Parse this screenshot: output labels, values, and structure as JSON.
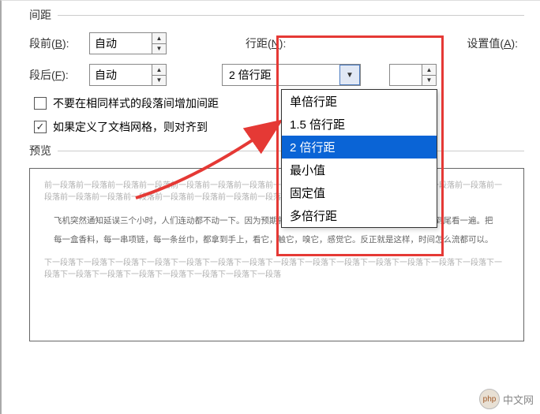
{
  "spacing": {
    "title": "间距",
    "before_label": "段前(B):",
    "after_label": "段后(F):",
    "before_value": "自动",
    "after_value": "自动",
    "line_spacing_label": "行距(N):",
    "line_spacing_value": "2 倍行距",
    "set_value_label": "设置值(A):",
    "set_value": ""
  },
  "dropdown_options": [
    "单倍行距",
    "1.5 倍行距",
    "2 倍行距",
    "最小值",
    "固定值",
    "多倍行距"
  ],
  "dropdown_selected_index": 2,
  "checkboxes": {
    "no_space_same_style": {
      "label": "不要在相同样式的段落间增加间距",
      "checked": false
    },
    "snap_to_grid": {
      "label": "如果定义了文档网格，则对齐到",
      "checked": true
    }
  },
  "preview": {
    "title": "预览",
    "faded_before": "前一段落前一段落前一段落前一段落前一段落前一段落前一段落前一段落前一段落前一段落前一段落前一段落前一段落前一段落前一段落前一段落前一段落前一段落前一段落前一段落前一段落前一段落前一段落",
    "sample": "飞机突然通知延误三个小时，人们连动都不动一下。因为预期就是这样，于是可以闲暇的把机场商店从头到尾看一遍。把每一盒香料，每一串项链，每一条丝巾，都拿到手上，看它，触它，嗅它，感觉它。反正就是这样，时间怎么流都可以。",
    "faded_after": "下一段落下一段落下一段落下一段落下一段落下一段落下一段落下一段落下一段落下一段落下一段落下一段落下一段落下一段落下一段落下一段落下一段落下一段落下一段落下一段落下一段落下一段落"
  },
  "watermark": "中文网"
}
